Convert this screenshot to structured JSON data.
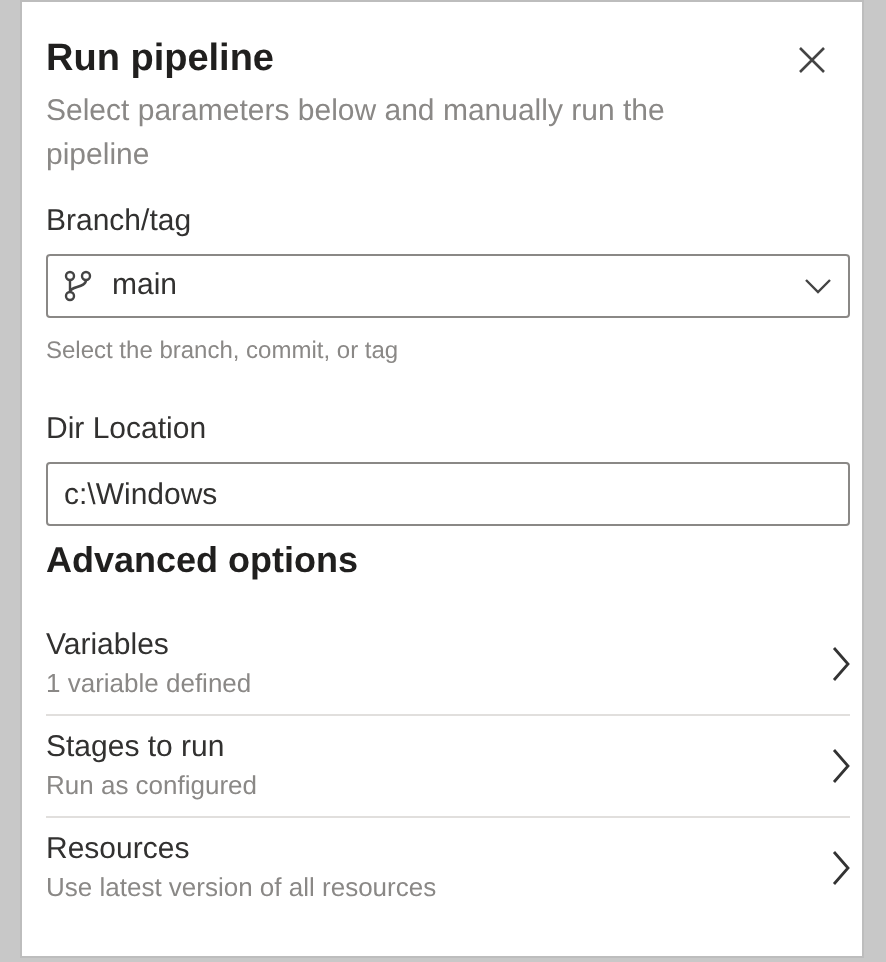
{
  "panel": {
    "title": "Run pipeline",
    "subtitle": "Select parameters below and manually run the pipeline"
  },
  "branch": {
    "label": "Branch/tag",
    "value": "main",
    "help": "Select the branch, commit, or tag"
  },
  "dir": {
    "label": "Dir Location",
    "value": "c:\\Windows"
  },
  "advanced": {
    "heading": "Advanced options",
    "items": [
      {
        "title": "Variables",
        "subtitle": "1 variable defined"
      },
      {
        "title": "Stages to run",
        "subtitle": "Run as configured"
      },
      {
        "title": "Resources",
        "subtitle": "Use latest version of all resources"
      }
    ]
  }
}
